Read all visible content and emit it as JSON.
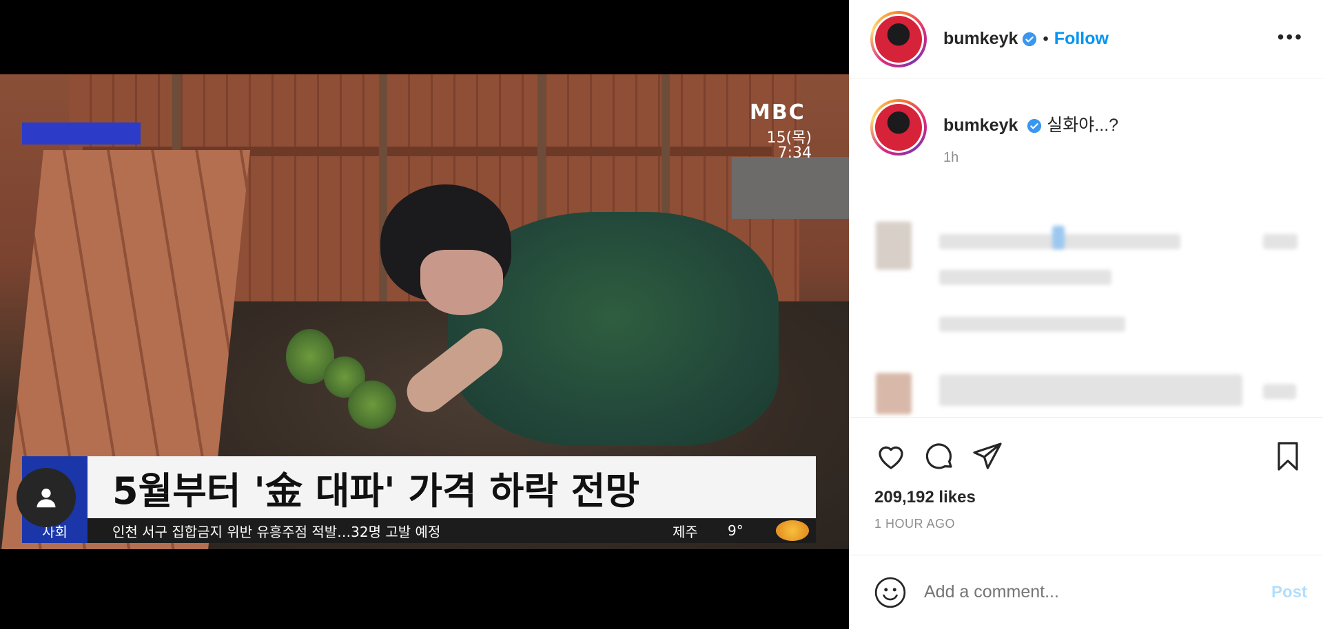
{
  "video": {
    "broadcaster": "MBC",
    "date": "15(목)",
    "time": "7:34",
    "headline": "5월부터 '金 대파' 가격 하락 전망",
    "ticker_category": "사회",
    "ticker_text": "인천 서구 집합금지 위반 유흥주점 적발…32명 고발 예정",
    "ticker_region": "제주",
    "ticker_temp": "9°"
  },
  "header": {
    "username": "bumkeyk",
    "separator": "•",
    "follow_label": "Follow",
    "more_label": "•••"
  },
  "caption": {
    "username": "bumkeyk",
    "text": "실화야...?",
    "time": "1h"
  },
  "actions": {
    "likes": "209,192 likes",
    "post_time": "1 HOUR AGO"
  },
  "comment_box": {
    "placeholder": "Add a comment...",
    "post_label": "Post"
  },
  "colors": {
    "accent": "#0095f6",
    "post_disabled": "#b2dffc",
    "caption_blue": "#1a36a8"
  }
}
